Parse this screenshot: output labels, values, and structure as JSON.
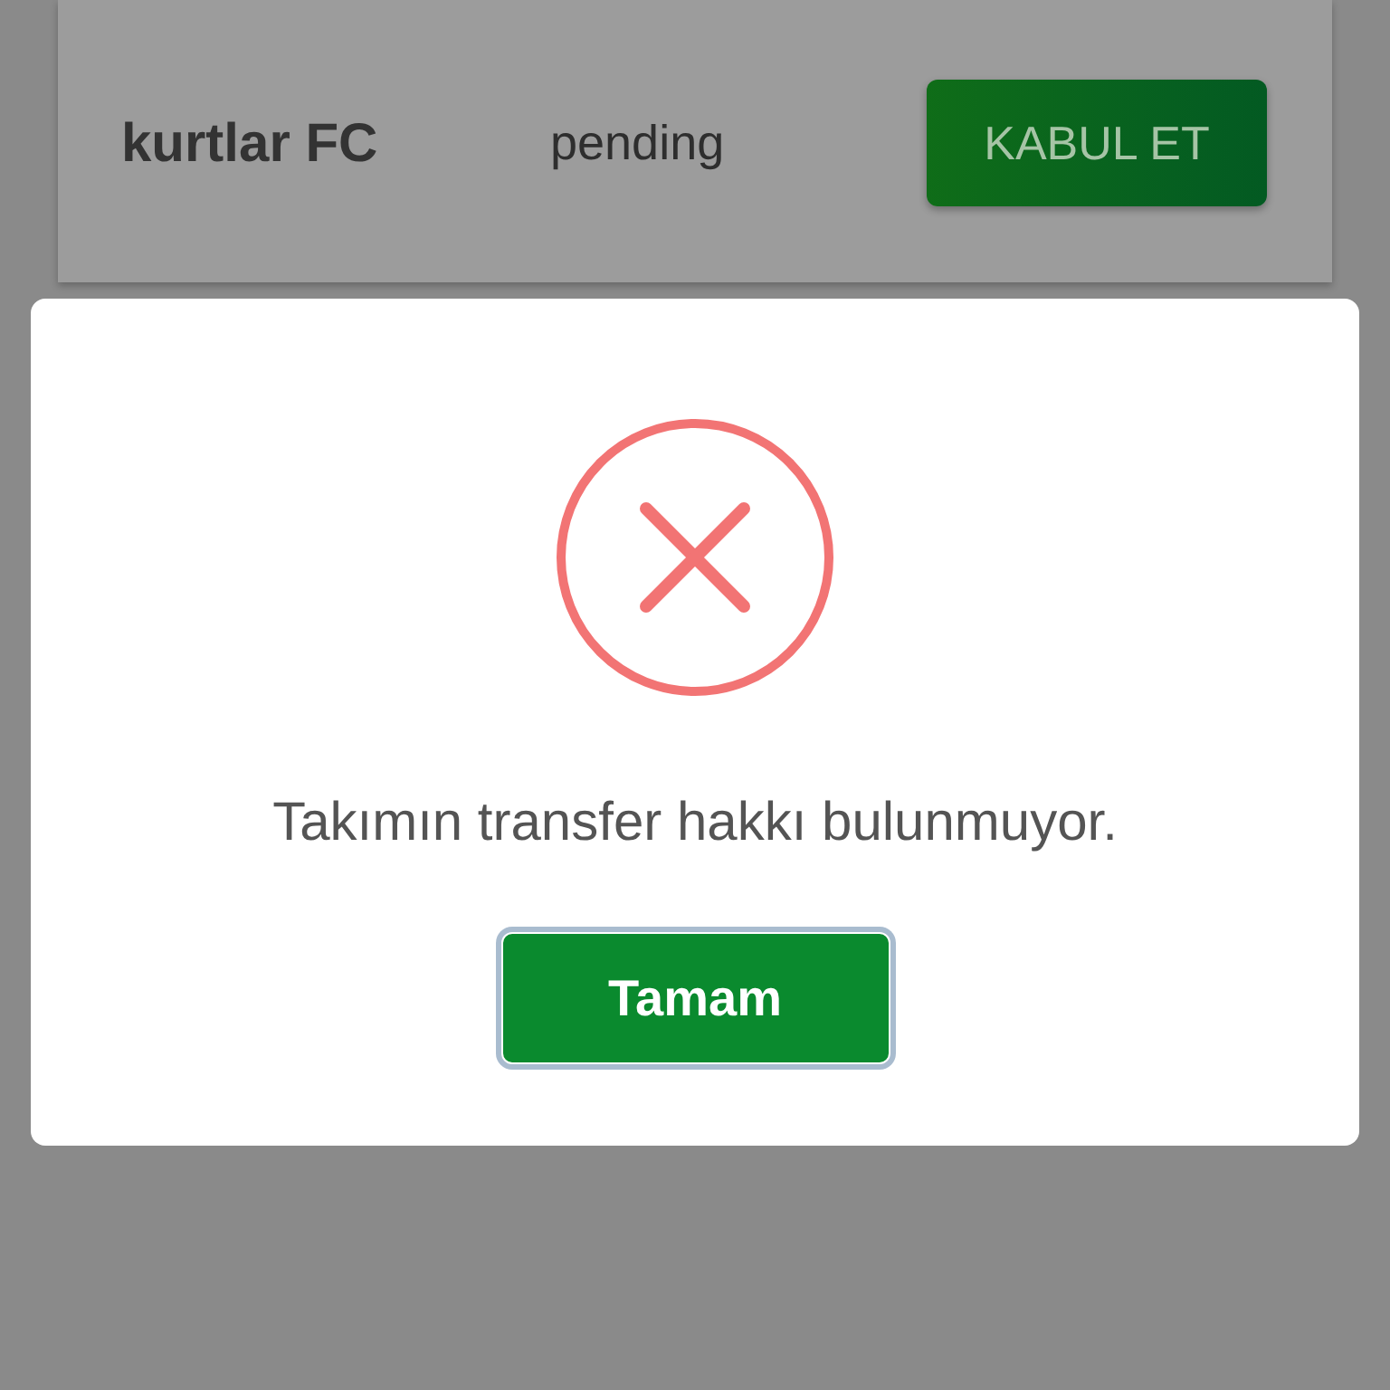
{
  "list_row": {
    "team": "kurtlar FC",
    "status": "pending",
    "accept_button": "KABUL ET"
  },
  "dialog": {
    "message": "Takımın transfer hakkı bulunmuyor.",
    "confirm_button": {
      "label": "Tamam",
      "focused": true
    }
  }
}
